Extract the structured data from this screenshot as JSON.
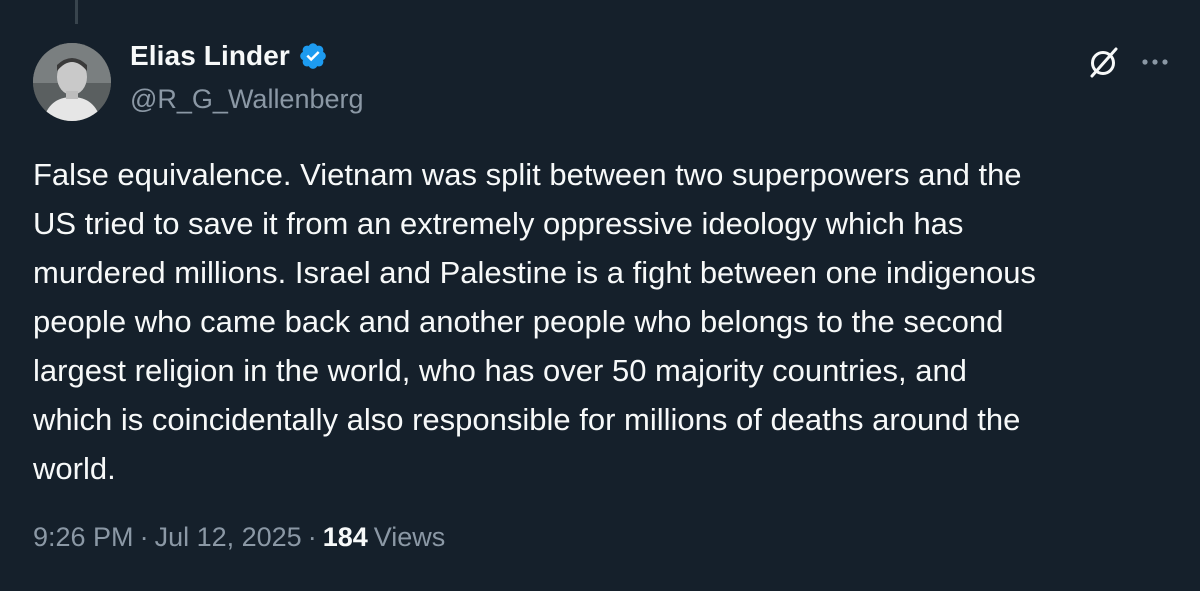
{
  "author": {
    "display_name": "Elias Linder",
    "handle": "@R_G_Wallenberg",
    "verified": true
  },
  "tweet": {
    "text": "False equivalence. Vietnam was split between two superpowers and the\nUS tried to save it from an extremely oppressive ideology which has\nmurdered millions. Israel and Palestine is a fight between one indigenous\npeople who came back and another people who belongs to the second\nlargest religion in the world, who has over 50 majority countries, and\nwhich is coincidentally also responsible for millions of deaths around the\nworld.",
    "time": "9:26 PM",
    "date": "Jul 12, 2025",
    "separator": "·",
    "views_count": "184",
    "views_label": "Views"
  },
  "icons": {
    "verified": "verified-badge-icon",
    "grok": "grok-icon",
    "more": "more-options-icon"
  },
  "colors": {
    "background": "#15202b",
    "text_primary": "#f7f9f9",
    "text_secondary": "#8b98a5",
    "verified_blue": "#1d9bf0",
    "thread_line": "#38444d"
  }
}
